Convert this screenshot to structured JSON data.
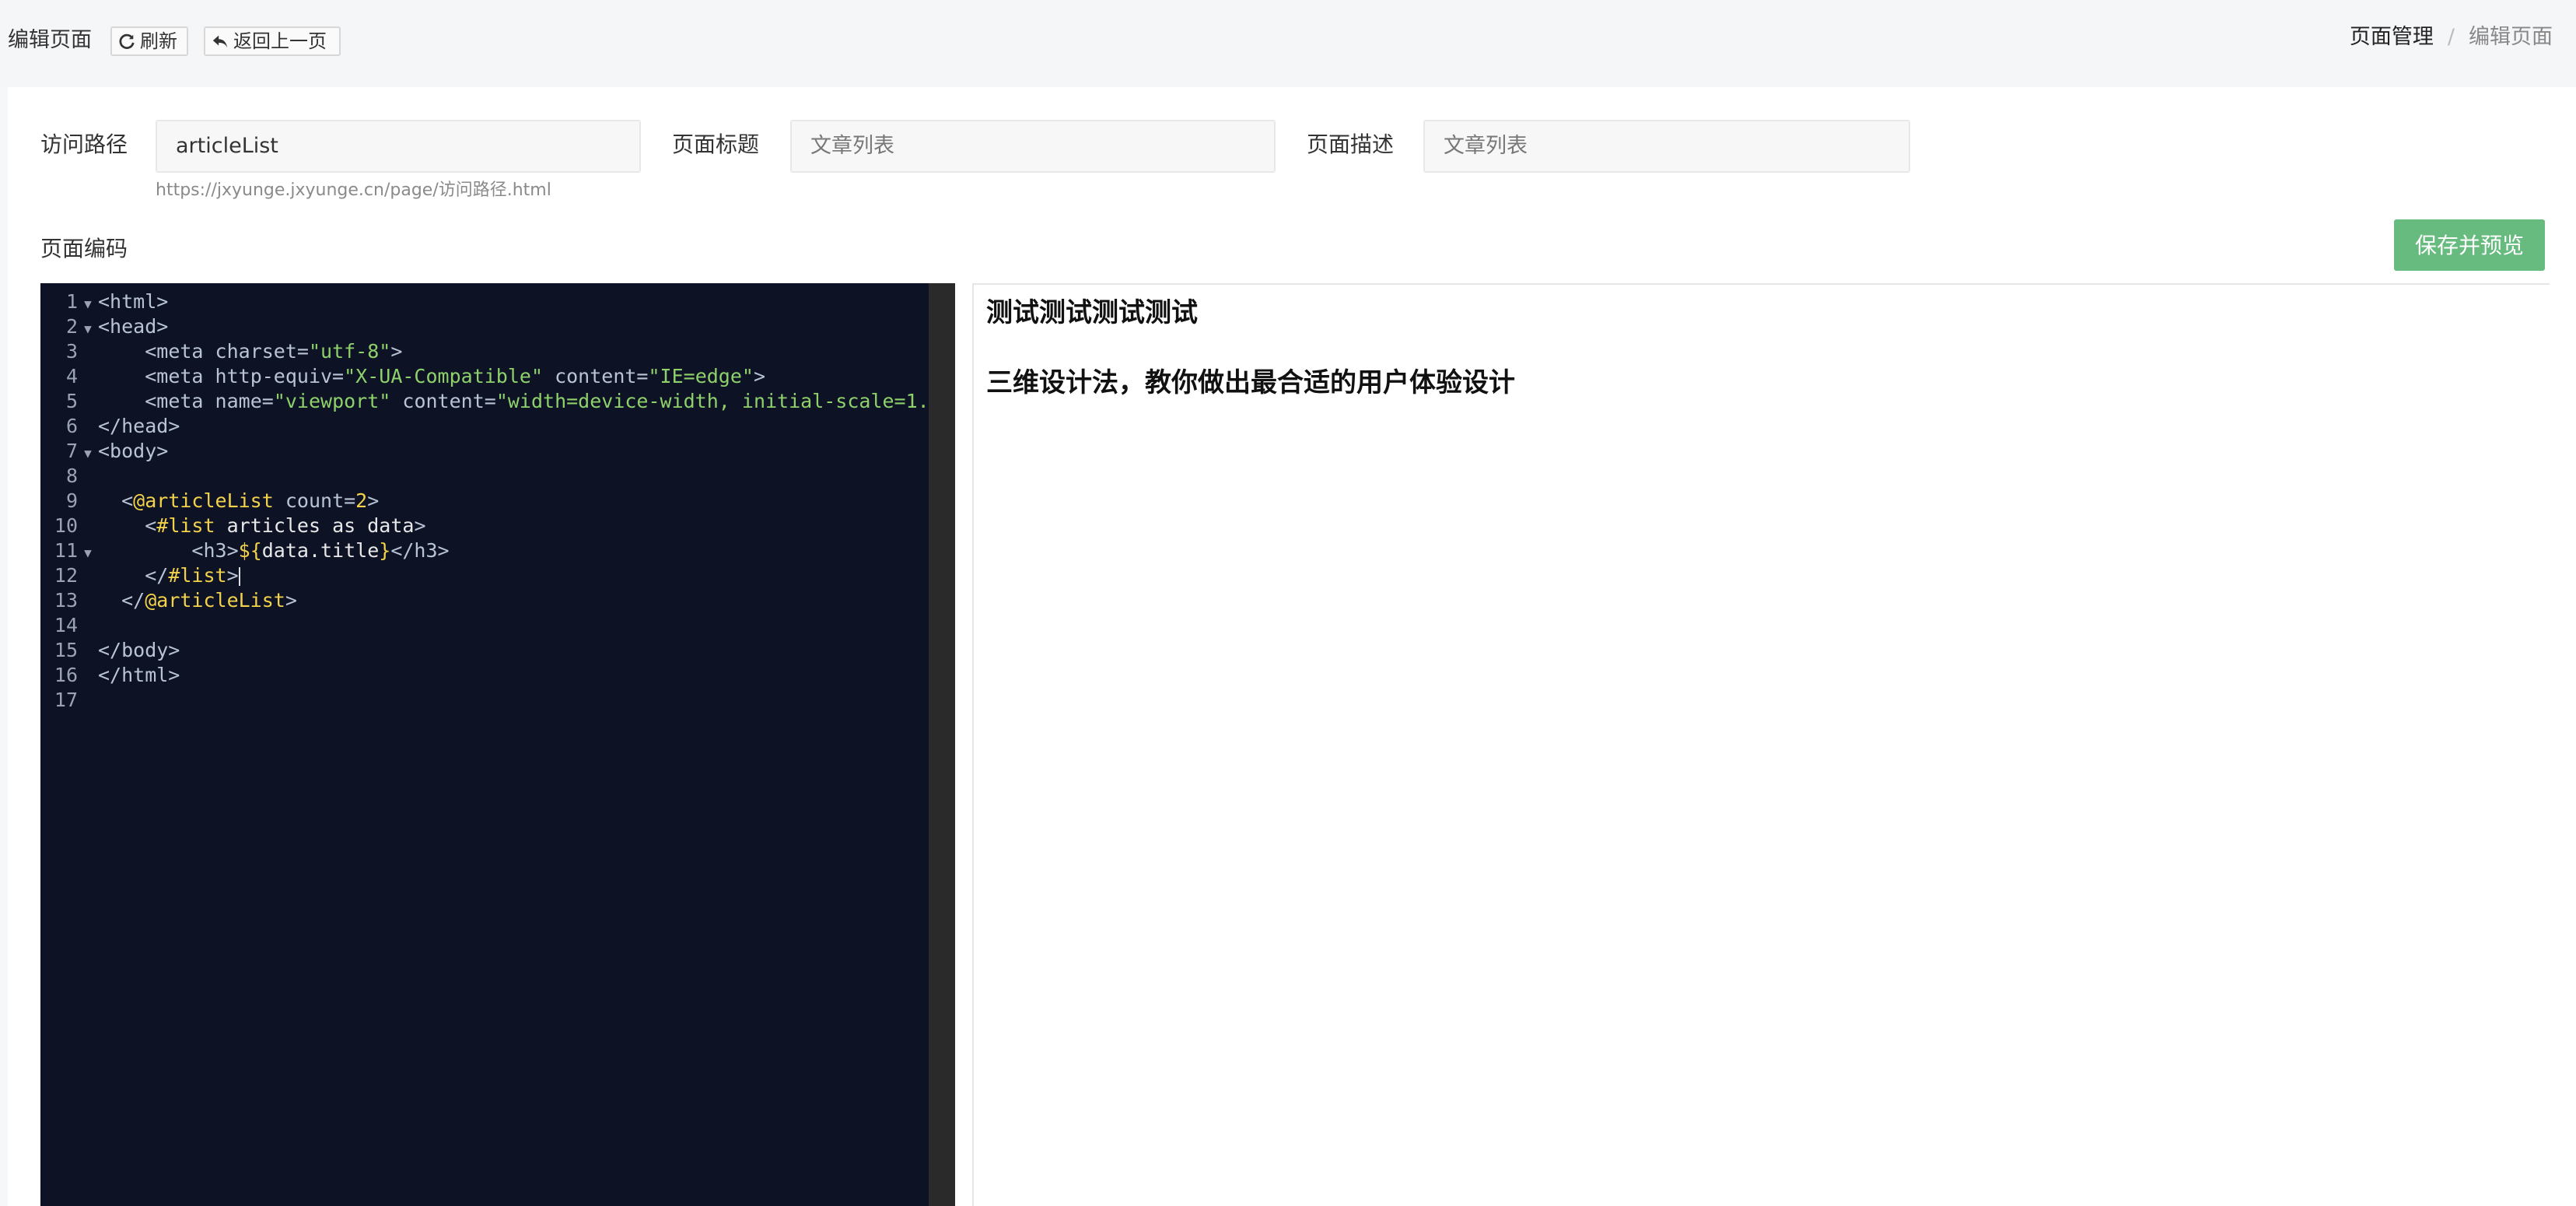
{
  "header": {
    "page_name": "编辑页面",
    "refresh_label": "刷新",
    "back_label": "返回上一页",
    "breadcrumb": [
      "页面管理",
      "/",
      "编辑页面"
    ]
  },
  "form": {
    "path_label": "访问路径",
    "path_value": "articleList",
    "title_label": "页面标题",
    "title_placeholder": "文章列表",
    "desc_label": "页面描述",
    "desc_placeholder": "文章列表",
    "hint": "https://jxyunge.jxyunge.cn/page/访问路径.html",
    "code_label": "页面编码",
    "save_label": "保存并预览"
  },
  "editor": {
    "lines": [
      {
        "n": "1",
        "fold": true
      },
      {
        "n": "2",
        "fold": true
      },
      {
        "n": "3",
        "fold": false
      },
      {
        "n": "4",
        "fold": false
      },
      {
        "n": "5",
        "fold": false
      },
      {
        "n": "6",
        "fold": false
      },
      {
        "n": "7",
        "fold": true
      },
      {
        "n": "8",
        "fold": false
      },
      {
        "n": "9",
        "fold": false
      },
      {
        "n": "10",
        "fold": false
      },
      {
        "n": "11",
        "fold": true
      },
      {
        "n": "12",
        "fold": false
      },
      {
        "n": "13",
        "fold": false
      },
      {
        "n": "14",
        "fold": false
      },
      {
        "n": "15",
        "fold": false
      },
      {
        "n": "16",
        "fold": false
      },
      {
        "n": "17",
        "fold": false
      }
    ]
  },
  "preview": {
    "headings": [
      "测试测试测试测试",
      "三维设计法，教你做出最合适的用户体验设计"
    ]
  }
}
